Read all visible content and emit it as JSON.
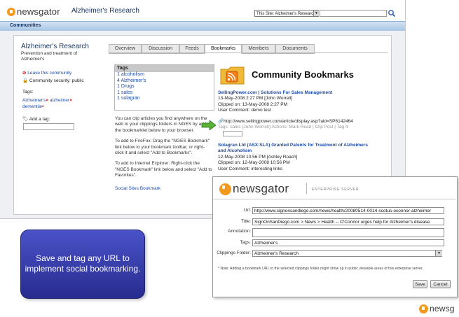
{
  "header": {
    "brand": "newsgator",
    "community_name": "Alzheimer's Research",
    "site_select": "This Site: Alzheimer's Research"
  },
  "navbar": {
    "label": "Communities"
  },
  "sidebar": {
    "title": "Alzheimer's Research",
    "description": "Prevention and treatment of Alzheimer's",
    "leave": "Leave this community",
    "security": "Community security: public",
    "tags_label": "Tags:",
    "tags": [
      "Alzheimer's",
      "alzheimer",
      "dementia"
    ],
    "add_tag_label": "Add a tag:"
  },
  "tabs": [
    "Overview",
    "Discussion",
    "Feeds",
    "Bookmarks",
    "Members",
    "Documents"
  ],
  "tags_box": {
    "header": "Tags",
    "items": [
      "1 alcoholism",
      "4 Alzheimer's",
      "1 Drugs",
      "1 sales",
      "1 solagran"
    ]
  },
  "help": {
    "p1": "You can clip articles you find anywhere on the web to your clippings folders in NGES by adding the bookmarklet below to your browser.",
    "p2": "To add to FireFox: Drag the \"NGES Bookmark\" link below to your bookmark toolbar, or right-click it and select \"Add to Bookmarks\".",
    "p3": "To add to Internet Explorer: Right-click the \"NGES Bookmark\" link below and select \"Add to Favorites\".",
    "bookmarklet": "Social Sites Bookmark"
  },
  "bookmarks": {
    "heading": "Community Bookmarks",
    "entry1": {
      "title": "SellingPower.com | Solutions For Sales Management",
      "line1": "13-May-2008 2:27 PM [John Worrell]",
      "line2": "Clipped on: 13-May-2008 2:27 PM",
      "line3": "User Comment: demo test",
      "url": "http://www.sellingpower.com/article/display.asp?aid=SP6142464",
      "tags_line": "Tags:  sales  (John Worrell)   Actions: Mark Read | Clip Post | Tag It"
    },
    "entry2": {
      "title": "Solagran Ltd (ASX:SLA) Granted Patents for Treatment of Alzheimers and Alcoholism",
      "line1": "12-May-2008 10:56 PM [Ashley Roach]",
      "line2": "Clipped on: 12-May-2008 10:56 PM",
      "line3": "User Comment: interesting links"
    }
  },
  "dialog": {
    "subtitle": "ENTERPRISE SERVER",
    "url_label": "Url:",
    "url": "http://www.signonsandiego.com/news/health/20080514-0014-scotus-oconnor-alzheimer",
    "title_label": "Title:",
    "title": "SignOnSanDiego.com > News > Health -- O'Connor urges help for Alzheimer's disease",
    "annotation_label": "Annotation:",
    "annotation": "",
    "tags_label": "Tags:",
    "tags": "Alzheimer's",
    "folder_label": "Clippings Folder:",
    "folder": "Alzheimer's Research",
    "note": "* Note: Adding a bookmark URL to the selected clippings folder might show up in public viewable areas of this enterprise server.",
    "save": "Save",
    "cancel": "Cancel"
  },
  "callout": {
    "text": "Save and tag any URL to implement social bookmarking."
  },
  "footer_brand": "newsg"
}
